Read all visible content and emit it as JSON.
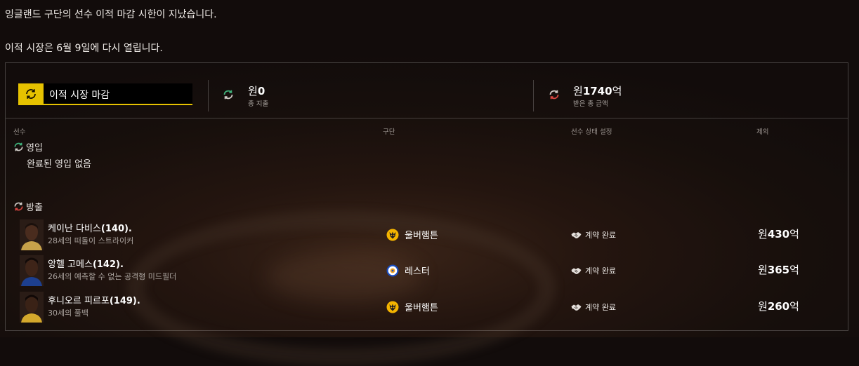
{
  "messages": {
    "line1": "잉글랜드 구단의 선수 이적 마감 시한이 지났습니다.",
    "line2": "이적 시장은 6월 9일에 다시 열립니다."
  },
  "summary": {
    "window_label": "이적 시장 마감",
    "spend": {
      "currency": "원",
      "amount": "0",
      "label": "총 지출"
    },
    "received": {
      "currency": "원",
      "amount": "1740",
      "unit": "억",
      "label": "받은 총 금액"
    }
  },
  "columns": {
    "player": "선수",
    "club": "구단",
    "status": "선수 상태 설정",
    "offer": "제의"
  },
  "incoming": {
    "title": "영입",
    "empty_text": "완료된 영입 없음"
  },
  "outgoing": {
    "title": "방출",
    "rows": [
      {
        "name": "케이난 다비스",
        "rating": "(140).",
        "desc": "28세의 떠돌이 스트라이커",
        "club": "울버햄튼",
        "club_icon": "wolves-crest-icon",
        "status": "계약 완료",
        "fee_currency": "원",
        "fee_amount": "430",
        "fee_unit": "억"
      },
      {
        "name": "앙헬 고메스",
        "rating": "(142).",
        "desc": "26세의 예측할 수 없는 공격형 미드필더",
        "club": "레스터",
        "club_icon": "leicester-crest-icon",
        "status": "계약 완료",
        "fee_currency": "원",
        "fee_amount": "365",
        "fee_unit": "억"
      },
      {
        "name": "후니오르 피르포",
        "rating": "(149).",
        "desc": "30세의 풀백",
        "club": "울버햄튼",
        "club_icon": "wolves-crest-icon",
        "status": "계약 완료",
        "fee_currency": "원",
        "fee_amount": "260",
        "fee_unit": "억"
      }
    ]
  },
  "colors": {
    "accent": "#e6c200",
    "in_arrow": "#3fb07a",
    "out_arrow": "#d64540"
  }
}
